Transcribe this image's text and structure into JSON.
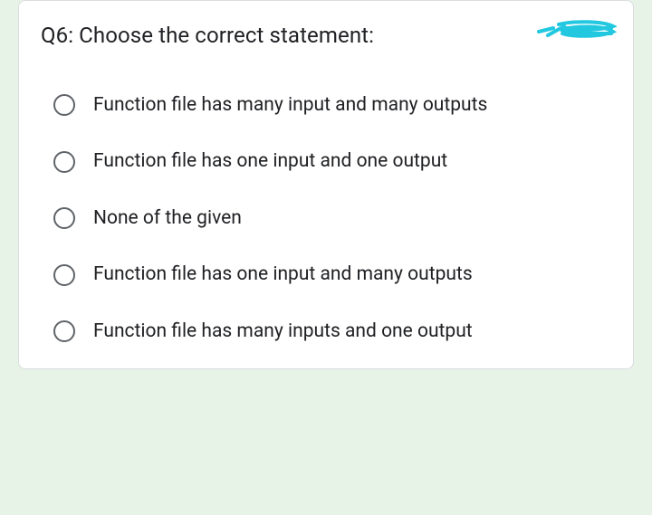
{
  "question": {
    "title": "Q6: Choose the correct statement:"
  },
  "options": [
    {
      "label": "Function file has many input and many outputs"
    },
    {
      "label": "Function file has one input and one output"
    },
    {
      "label": "None of the given"
    },
    {
      "label": "Function file has one input and many outputs"
    },
    {
      "label": "Function file has many inputs and one output"
    }
  ]
}
